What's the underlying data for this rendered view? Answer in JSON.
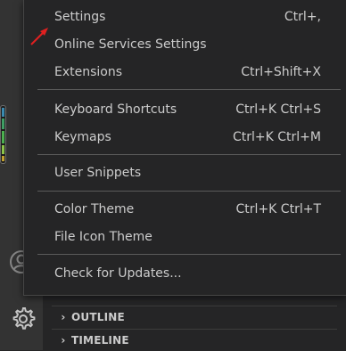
{
  "menu": {
    "groups": [
      {
        "items": [
          {
            "label": "Settings",
            "shortcut": "Ctrl+,"
          },
          {
            "label": "Online Services Settings",
            "shortcut": ""
          },
          {
            "label": "Extensions",
            "shortcut": "Ctrl+Shift+X"
          }
        ]
      },
      {
        "items": [
          {
            "label": "Keyboard Shortcuts",
            "shortcut": "Ctrl+K Ctrl+S"
          },
          {
            "label": "Keymaps",
            "shortcut": "Ctrl+K Ctrl+M"
          }
        ]
      },
      {
        "items": [
          {
            "label": "User Snippets",
            "shortcut": ""
          }
        ]
      },
      {
        "items": [
          {
            "label": "Color Theme",
            "shortcut": "Ctrl+K Ctrl+T"
          },
          {
            "label": "File Icon Theme",
            "shortcut": ""
          }
        ]
      },
      {
        "items": [
          {
            "label": "Check for Updates...",
            "shortcut": ""
          }
        ]
      }
    ]
  },
  "panels": {
    "outline": {
      "title": "OUTLINE",
      "chevron": "›"
    },
    "timeline": {
      "title": "TIMELINE",
      "chevron": "›"
    }
  },
  "icons": {
    "account": "account-icon",
    "manage": "gear-icon",
    "annotation": "red-arrow-icon"
  },
  "colors": {
    "menu_background": "#252526",
    "activity_bar": "#333333",
    "text": "#cccccc",
    "separator": "#5a5a5a",
    "annotation": "#e02020"
  }
}
